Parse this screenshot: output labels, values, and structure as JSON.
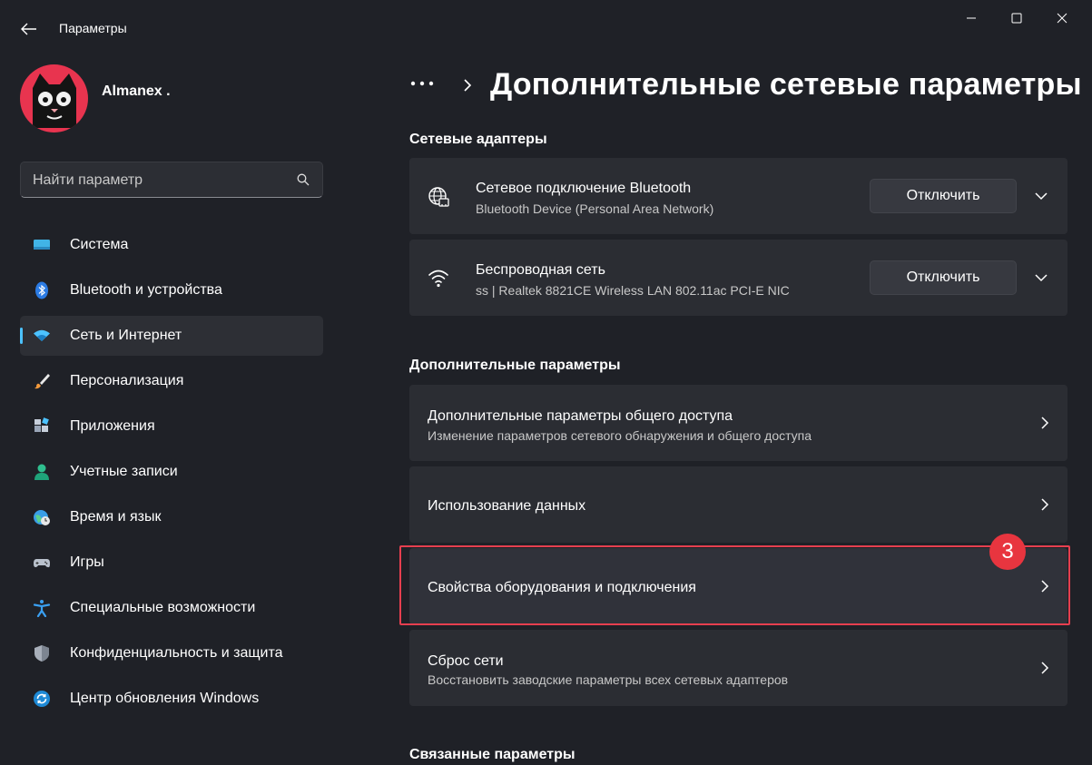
{
  "window": {
    "title": "Параметры",
    "controls": [
      "minimize-icon",
      "maximize-icon",
      "close-icon"
    ]
  },
  "profile": {
    "name": "Almanex ."
  },
  "search": {
    "placeholder": "Найти параметр"
  },
  "sidebar": {
    "items": [
      {
        "label": "Система",
        "icon": "display-icon",
        "active": false
      },
      {
        "label": "Bluetooth и устройства",
        "icon": "bluetooth-icon",
        "active": false
      },
      {
        "label": "Сеть и Интернет",
        "icon": "wifi-icon",
        "active": true
      },
      {
        "label": "Персонализация",
        "icon": "brush-icon",
        "active": false
      },
      {
        "label": "Приложения",
        "icon": "apps-icon",
        "active": false
      },
      {
        "label": "Учетные записи",
        "icon": "person-icon",
        "active": false
      },
      {
        "label": "Время и язык",
        "icon": "globe-clock-icon",
        "active": false
      },
      {
        "label": "Игры",
        "icon": "gamepad-icon",
        "active": false
      },
      {
        "label": "Специальные возможности",
        "icon": "accessibility-icon",
        "active": false
      },
      {
        "label": "Конфиденциальность и защита",
        "icon": "shield-icon",
        "active": false
      },
      {
        "label": "Центр обновления Windows",
        "icon": "update-icon",
        "active": false
      }
    ]
  },
  "header": {
    "breadcrumb_more": "•••",
    "title": "Дополнительные сетевые параметры"
  },
  "sections": {
    "adapters": {
      "heading": "Сетевые адаптеры",
      "items": [
        {
          "title": "Сетевое подключение Bluetooth",
          "subtitle": "Bluetooth Device (Personal Area Network)",
          "button": "Отключить",
          "icon": "network-globe-icon"
        },
        {
          "title": "Беспроводная сеть",
          "subtitle": "ss | Realtek 8821CE Wireless LAN 802.11ac PCI-E NIC",
          "button": "Отключить",
          "icon": "wifi-icon"
        }
      ]
    },
    "advanced": {
      "heading": "Дополнительные параметры",
      "items": [
        {
          "title": "Дополнительные параметры общего доступа",
          "subtitle": "Изменение параметров сетевого обнаружения и общего доступа"
        },
        {
          "title": "Использование данных",
          "subtitle": ""
        },
        {
          "title": "Свойства оборудования и подключения",
          "subtitle": "",
          "highlighted": true
        },
        {
          "title": "Сброс сети",
          "subtitle": "Восстановить заводские параметры всех сетевых адаптеров"
        }
      ]
    },
    "related": {
      "heading": "Связанные параметры"
    }
  },
  "annotation": {
    "step": "3",
    "color": "#e8353f"
  },
  "colors": {
    "background": "#1f2127",
    "card": "#2b2d33",
    "accent": "#4cc2ff"
  }
}
